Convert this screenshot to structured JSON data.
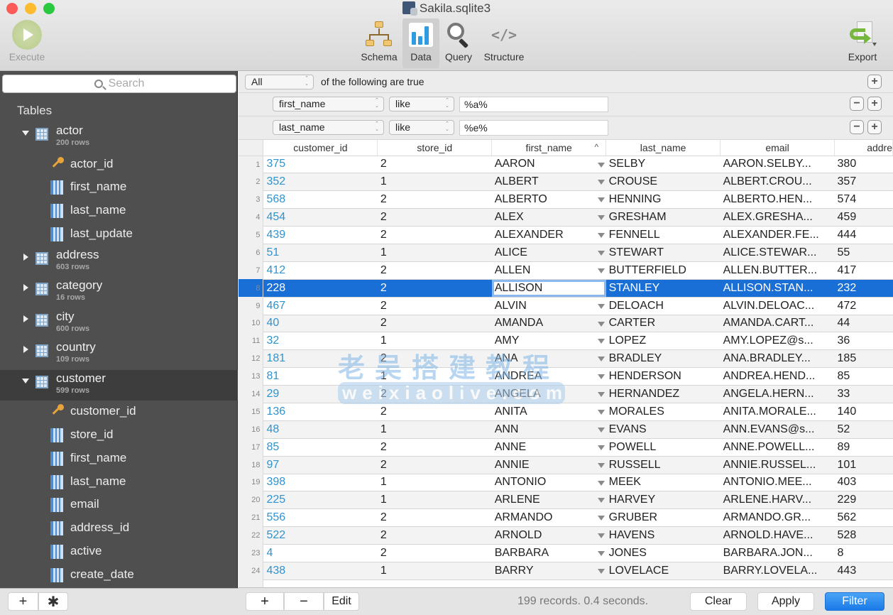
{
  "window": {
    "title": "Sakila.sqlite3"
  },
  "toolbar": {
    "execute_label": "Execute",
    "segments": [
      {
        "id": "schema",
        "label": "Schema",
        "icon": "schema-icon"
      },
      {
        "id": "data",
        "label": "Data",
        "icon": "bar-chart-icon",
        "selected": true
      },
      {
        "id": "query",
        "label": "Query",
        "icon": "magnifier-icon"
      },
      {
        "id": "structure",
        "label": "Structure",
        "icon": "code-brackets-icon"
      }
    ],
    "structure_glyph": "</>",
    "export_label": "Export"
  },
  "sidebar": {
    "search_placeholder": "Search",
    "heading": "Tables",
    "tables": [
      {
        "name": "actor",
        "rows": "200 rows",
        "expanded": true,
        "columns": [
          {
            "name": "actor_id",
            "key": true
          },
          {
            "name": "first_name"
          },
          {
            "name": "last_name"
          },
          {
            "name": "last_update"
          }
        ]
      },
      {
        "name": "address",
        "rows": "603 rows",
        "expanded": false
      },
      {
        "name": "category",
        "rows": "16 rows",
        "expanded": false
      },
      {
        "name": "city",
        "rows": "600 rows",
        "expanded": false
      },
      {
        "name": "country",
        "rows": "109 rows",
        "expanded": false
      },
      {
        "name": "customer",
        "rows": "599 rows",
        "expanded": true,
        "selected": true,
        "columns": [
          {
            "name": "customer_id",
            "key": true
          },
          {
            "name": "store_id"
          },
          {
            "name": "first_name"
          },
          {
            "name": "last_name"
          },
          {
            "name": "email"
          },
          {
            "name": "address_id"
          },
          {
            "name": "active"
          },
          {
            "name": "create_date"
          }
        ]
      }
    ],
    "add_label": "+",
    "gear_label": "✱"
  },
  "filter": {
    "match_mode": "All",
    "match_text": "of the following are true",
    "rules": [
      {
        "column": "first_name",
        "operator": "like",
        "value": "%a%"
      },
      {
        "column": "last_name",
        "operator": "like",
        "value": "%e%"
      }
    ],
    "plus": "+",
    "minus": "−"
  },
  "grid": {
    "columns": [
      "customer_id",
      "store_id",
      "first_name",
      "last_name",
      "email",
      "addre"
    ],
    "sorted_column": "first_name",
    "sort_glyph": "^",
    "selected_row": 8,
    "editing_cell": "first_name",
    "rows": [
      {
        "n": "1",
        "customer_id": "375",
        "store_id": "2",
        "first_name": "AARON",
        "last_name": "SELBY",
        "email": "AARON.SELBY...",
        "address_id": "380"
      },
      {
        "n": "2",
        "customer_id": "352",
        "store_id": "1",
        "first_name": "ALBERT",
        "last_name": "CROUSE",
        "email": "ALBERT.CROU...",
        "address_id": "357"
      },
      {
        "n": "3",
        "customer_id": "568",
        "store_id": "2",
        "first_name": "ALBERTO",
        "last_name": "HENNING",
        "email": "ALBERTO.HEN...",
        "address_id": "574"
      },
      {
        "n": "4",
        "customer_id": "454",
        "store_id": "2",
        "first_name": "ALEX",
        "last_name": "GRESHAM",
        "email": "ALEX.GRESHA...",
        "address_id": "459"
      },
      {
        "n": "5",
        "customer_id": "439",
        "store_id": "2",
        "first_name": "ALEXANDER",
        "last_name": "FENNELL",
        "email": "ALEXANDER.FE...",
        "address_id": "444"
      },
      {
        "n": "6",
        "customer_id": "51",
        "store_id": "1",
        "first_name": "ALICE",
        "last_name": "STEWART",
        "email": "ALICE.STEWAR...",
        "address_id": "55"
      },
      {
        "n": "7",
        "customer_id": "412",
        "store_id": "2",
        "first_name": "ALLEN",
        "last_name": "BUTTERFIELD",
        "email": "ALLEN.BUTTER...",
        "address_id": "417"
      },
      {
        "n": "8",
        "customer_id": "228",
        "store_id": "2",
        "first_name": "ALLISON",
        "last_name": "STANLEY",
        "email": "ALLISON.STAN...",
        "address_id": "232"
      },
      {
        "n": "9",
        "customer_id": "467",
        "store_id": "2",
        "first_name": "ALVIN",
        "last_name": "DELOACH",
        "email": "ALVIN.DELOAC...",
        "address_id": "472"
      },
      {
        "n": "10",
        "customer_id": "40",
        "store_id": "2",
        "first_name": "AMANDA",
        "last_name": "CARTER",
        "email": "AMANDA.CART...",
        "address_id": "44"
      },
      {
        "n": "11",
        "customer_id": "32",
        "store_id": "1",
        "first_name": "AMY",
        "last_name": "LOPEZ",
        "email": "AMY.LOPEZ@s...",
        "address_id": "36"
      },
      {
        "n": "12",
        "customer_id": "181",
        "store_id": "2",
        "first_name": "ANA",
        "last_name": "BRADLEY",
        "email": "ANA.BRADLEY...",
        "address_id": "185"
      },
      {
        "n": "13",
        "customer_id": "81",
        "store_id": "1",
        "first_name": "ANDREA",
        "last_name": "HENDERSON",
        "email": "ANDREA.HEND...",
        "address_id": "85"
      },
      {
        "n": "14",
        "customer_id": "29",
        "store_id": "2",
        "first_name": "ANGELA",
        "last_name": "HERNANDEZ",
        "email": "ANGELA.HERN...",
        "address_id": "33"
      },
      {
        "n": "15",
        "customer_id": "136",
        "store_id": "2",
        "first_name": "ANITA",
        "last_name": "MORALES",
        "email": "ANITA.MORALE...",
        "address_id": "140"
      },
      {
        "n": "16",
        "customer_id": "48",
        "store_id": "1",
        "first_name": "ANN",
        "last_name": "EVANS",
        "email": "ANN.EVANS@s...",
        "address_id": "52"
      },
      {
        "n": "17",
        "customer_id": "85",
        "store_id": "2",
        "first_name": "ANNE",
        "last_name": "POWELL",
        "email": "ANNE.POWELL...",
        "address_id": "89"
      },
      {
        "n": "18",
        "customer_id": "97",
        "store_id": "2",
        "first_name": "ANNIE",
        "last_name": "RUSSELL",
        "email": "ANNIE.RUSSEL...",
        "address_id": "101"
      },
      {
        "n": "19",
        "customer_id": "398",
        "store_id": "1",
        "first_name": "ANTONIO",
        "last_name": "MEEK",
        "email": "ANTONIO.MEE...",
        "address_id": "403"
      },
      {
        "n": "20",
        "customer_id": "225",
        "store_id": "1",
        "first_name": "ARLENE",
        "last_name": "HARVEY",
        "email": "ARLENE.HARV...",
        "address_id": "229"
      },
      {
        "n": "21",
        "customer_id": "556",
        "store_id": "2",
        "first_name": "ARMANDO",
        "last_name": "GRUBER",
        "email": "ARMANDO.GR...",
        "address_id": "562"
      },
      {
        "n": "22",
        "customer_id": "522",
        "store_id": "2",
        "first_name": "ARNOLD",
        "last_name": "HAVENS",
        "email": "ARNOLD.HAVE...",
        "address_id": "528"
      },
      {
        "n": "23",
        "customer_id": "4",
        "store_id": "2",
        "first_name": "BARBARA",
        "last_name": "JONES",
        "email": "BARBARA.JON...",
        "address_id": "8"
      },
      {
        "n": "24",
        "customer_id": "438",
        "store_id": "1",
        "first_name": "BARRY",
        "last_name": "LOVELACE",
        "email": "BARRY.LOVELA...",
        "address_id": "443"
      }
    ]
  },
  "bottom_bar": {
    "add_label": "+",
    "remove_label": "−",
    "edit_label": "Edit",
    "status": "199 records. 0.4 seconds.",
    "clear_label": "Clear",
    "apply_label": "Apply",
    "filter_label": "Filter"
  },
  "watermark": {
    "line1": "老吴搭建教程",
    "line2": "weixiaolive.com"
  },
  "colors": {
    "accent": "#1a70d5",
    "id_link": "#2f93d0",
    "sidebar_bg": "#4f4f4f",
    "selected_row": "#1a6fd6"
  }
}
